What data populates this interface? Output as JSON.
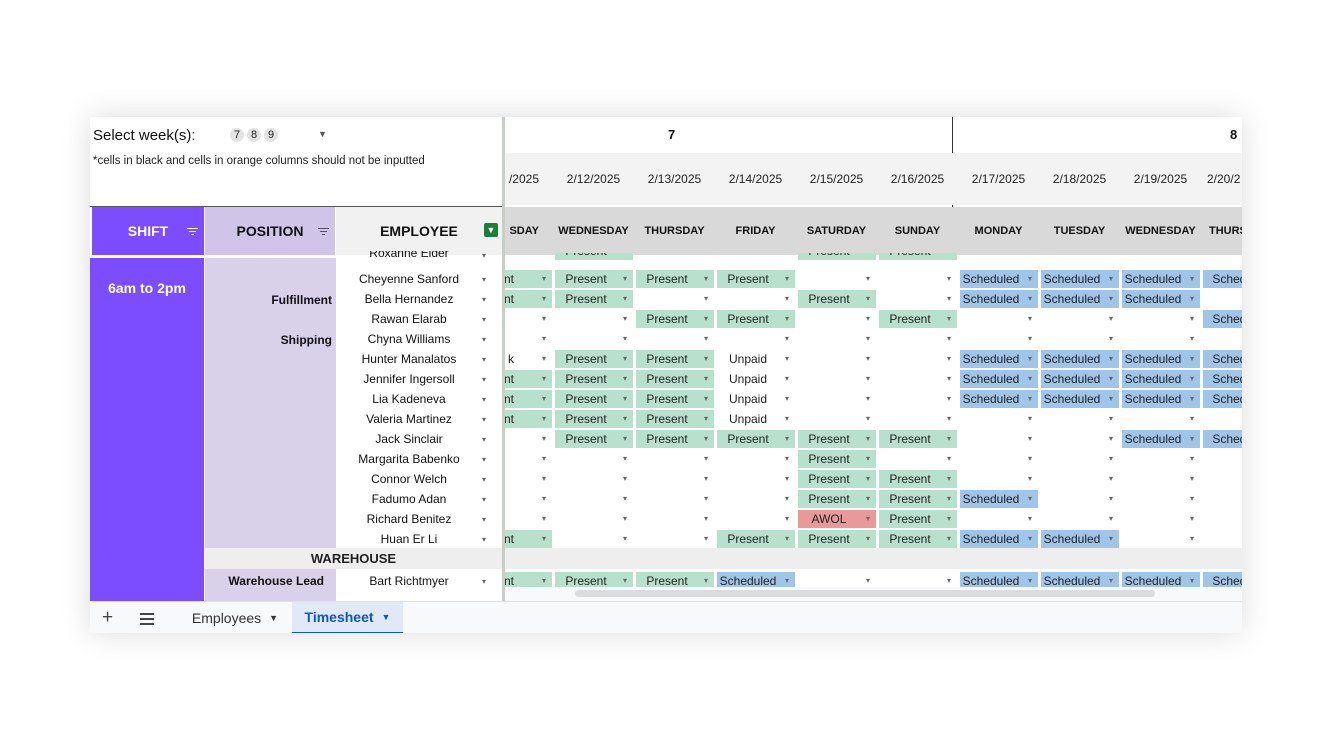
{
  "controls": {
    "select_label": "Select week(s):",
    "weeks": [
      "7",
      "8",
      "9"
    ],
    "note": "*cells in black and cells in orange columns should not be inputted"
  },
  "headers": {
    "shift": "SHIFT",
    "position": "POSITION",
    "employee": "EMPLOYEE"
  },
  "shift_label": "6am to 2pm",
  "positions": [
    "Fulfillment",
    "Shipping"
  ],
  "warehouse_section": "WAREHOUSE",
  "warehouse_lead": "Warehouse Lead",
  "employees": [
    "Roxanne Elder",
    "Cheyenne Sanford",
    "Bella Hernandez",
    "Rawan Elarab",
    "Chyna Williams",
    "Hunter Manalatos",
    "Jennifer Ingersoll",
    "Lia Kadeneva",
    "Valeria Martinez",
    "Jack Sinclair",
    "Margarita Babenko",
    "Connor Welch",
    "Fadumo Adan",
    "Richard Benitez",
    "Huan Er Li",
    "Bart Richtmyer"
  ],
  "week_numbers": [
    "7",
    "8"
  ],
  "columns": [
    {
      "date": "/2025",
      "day": "SDAY"
    },
    {
      "date": "2/12/2025",
      "day": "WEDNESDAY"
    },
    {
      "date": "2/13/2025",
      "day": "THURSDAY"
    },
    {
      "date": "2/14/2025",
      "day": "FRIDAY"
    },
    {
      "date": "2/15/2025",
      "day": "SATURDAY"
    },
    {
      "date": "2/16/2025",
      "day": "SUNDAY"
    },
    {
      "date": "2/17/2025",
      "day": "MONDAY"
    },
    {
      "date": "2/18/2025",
      "day": "TUESDAY"
    },
    {
      "date": "2/19/2025",
      "day": "WEDNESDAY"
    },
    {
      "date": "2/20/2",
      "day": "THURS"
    }
  ],
  "grid": [
    [
      "",
      "Present",
      "",
      "",
      "Present",
      "Present",
      "",
      "",
      "",
      ""
    ],
    [
      "ent",
      "Present",
      "Present",
      "Present",
      "",
      "",
      "Scheduled",
      "Scheduled",
      "Scheduled",
      "Schedul"
    ],
    [
      "ent",
      "Present",
      "",
      "",
      "Present",
      "",
      "Scheduled",
      "Scheduled",
      "Scheduled",
      ""
    ],
    [
      "",
      "",
      "Present",
      "Present",
      "",
      "Present",
      "",
      "",
      "",
      "Schedul"
    ],
    [
      "",
      "",
      "",
      "",
      "",
      "",
      "",
      "",
      "",
      ""
    ],
    [
      "k",
      "Present",
      "Present",
      "Unpaid",
      "",
      "",
      "Scheduled",
      "Scheduled",
      "Scheduled",
      "Schedul"
    ],
    [
      "ent",
      "Present",
      "Present",
      "Unpaid",
      "",
      "",
      "Scheduled",
      "Scheduled",
      "Scheduled",
      "Schedul"
    ],
    [
      "ent",
      "Present",
      "Present",
      "Unpaid",
      "",
      "",
      "Scheduled",
      "Scheduled",
      "Scheduled",
      "Schedul"
    ],
    [
      "ent",
      "Present",
      "Present",
      "Unpaid",
      "",
      "",
      "",
      "",
      "",
      ""
    ],
    [
      "",
      "Present",
      "Present",
      "Present",
      "Present",
      "Present",
      "",
      "",
      "Scheduled",
      "Schedul"
    ],
    [
      "",
      "",
      "",
      "",
      "Present",
      "",
      "",
      "",
      "",
      ""
    ],
    [
      "",
      "",
      "",
      "",
      "Present",
      "Present",
      "",
      "",
      "",
      ""
    ],
    [
      "",
      "",
      "",
      "",
      "Present",
      "Present",
      "Scheduled",
      "",
      "",
      ""
    ],
    [
      "",
      "",
      "",
      "",
      "AWOL",
      "Present",
      "",
      "",
      "",
      ""
    ],
    [
      "ent",
      "",
      "",
      "Present",
      "Present",
      "Present",
      "Scheduled",
      "Scheduled",
      "",
      ""
    ],
    [
      "ent",
      "Present",
      "Present",
      "Scheduled",
      "",
      "",
      "Scheduled",
      "Scheduled",
      "Scheduled",
      "Schedul"
    ]
  ],
  "sheet_tabs": [
    "Employees",
    "Timesheet"
  ],
  "active_tab": "Timesheet",
  "colors": {
    "shift": "#7c4dff",
    "position": "#d1c4e9",
    "present": "#b7e1cd",
    "scheduled": "#9fc5e8",
    "awol": "#ea9999",
    "active_tab": "#0b57d0"
  },
  "icons": {
    "add_sheet": "+",
    "all_sheets": "menu-icon",
    "filter": "filter-lines-icon",
    "filter_active": "funnel-icon",
    "dropdown": "▾"
  }
}
